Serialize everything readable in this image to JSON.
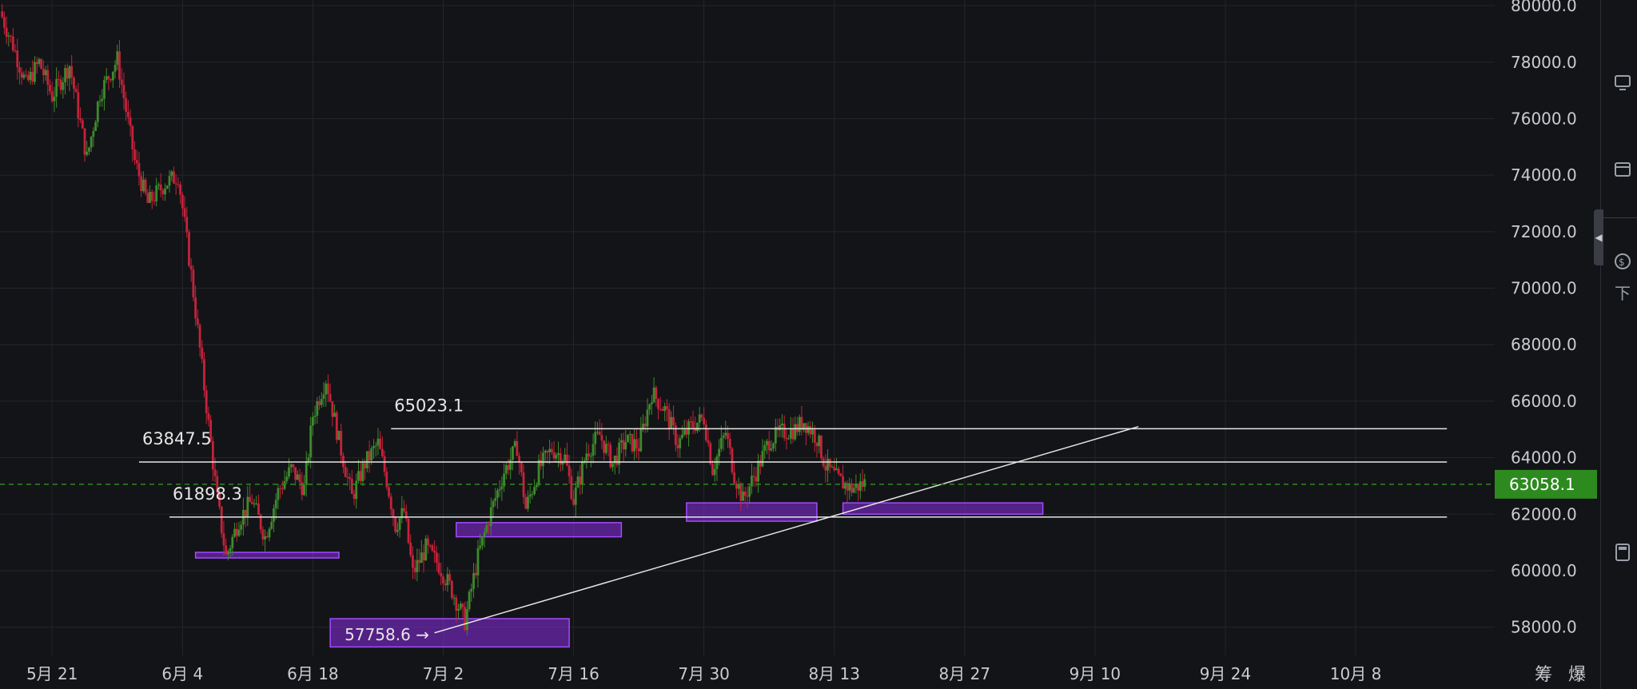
{
  "chart_data": {
    "type": "candlestick",
    "y_ticks": [
      "80000.0",
      "78000.0",
      "76000.0",
      "74000.0",
      "72000.0",
      "70000.0",
      "68000.0",
      "66000.0",
      "64000.0",
      "62000.0",
      "60000.0",
      "58000.0"
    ],
    "ylim": [
      57000,
      80200
    ],
    "x_ticks": [
      "5月 21",
      "6月 4",
      "6月 18",
      "7月 2",
      "7月 16",
      "7月 30",
      "8月 13",
      "8月 27",
      "9月 10",
      "9月 24",
      "10月 8"
    ],
    "current_price": "63058.1",
    "price_path": [
      [
        0,
        79800
      ],
      [
        3,
        78600
      ],
      [
        6,
        77200
      ],
      [
        9,
        78000
      ],
      [
        12,
        76800
      ],
      [
        16,
        77900
      ],
      [
        20,
        74600
      ],
      [
        23,
        76900
      ],
      [
        27,
        78100
      ],
      [
        31,
        74500
      ],
      [
        34,
        73000
      ],
      [
        38,
        73700
      ],
      [
        41,
        74000
      ],
      [
        44,
        70500
      ],
      [
        47,
        66500
      ],
      [
        50,
        62500
      ],
      [
        52,
        60500
      ],
      [
        55,
        61800
      ],
      [
        58,
        62500
      ],
      [
        61,
        61200
      ],
      [
        64,
        62800
      ],
      [
        67,
        63600
      ],
      [
        70,
        62900
      ],
      [
        72,
        65500
      ],
      [
        75,
        66800
      ],
      [
        78,
        64600
      ],
      [
        81,
        62600
      ],
      [
        84,
        63800
      ],
      [
        87,
        64500
      ],
      [
        89,
        63200
      ],
      [
        91,
        61600
      ],
      [
        93,
        62100
      ],
      [
        95,
        59900
      ],
      [
        98,
        60800
      ],
      [
        101,
        60200
      ],
      [
        104,
        59300
      ],
      [
        107,
        58200
      ],
      [
        110,
        60500
      ],
      [
        113,
        62100
      ],
      [
        116,
        63500
      ],
      [
        119,
        64400
      ],
      [
        121,
        62200
      ],
      [
        124,
        63600
      ],
      [
        127,
        64300
      ],
      [
        130,
        64000
      ],
      [
        132,
        62500
      ],
      [
        135,
        64200
      ],
      [
        138,
        64800
      ],
      [
        141,
        63800
      ],
      [
        144,
        64600
      ],
      [
        147,
        64400
      ],
      [
        150,
        66300
      ],
      [
        153,
        65700
      ],
      [
        156,
        64500
      ],
      [
        159,
        65100
      ],
      [
        162,
        65400
      ],
      [
        164,
        63600
      ],
      [
        167,
        64900
      ],
      [
        169,
        63400
      ],
      [
        171,
        62500
      ],
      [
        174,
        63500
      ],
      [
        177,
        64600
      ],
      [
        180,
        64900
      ],
      [
        183,
        65000
      ],
      [
        185,
        65300
      ],
      [
        188,
        64700
      ],
      [
        190,
        63700
      ],
      [
        193,
        63200
      ],
      [
        196,
        62900
      ],
      [
        199,
        63100
      ]
    ],
    "x_domain": [
      0,
      344
    ],
    "x_tick_pos": [
      12,
      42,
      72,
      102,
      132,
      162,
      192,
      222,
      252,
      282,
      312
    ],
    "levels": [
      {
        "label": "65023.1",
        "value": 65023.1,
        "x_from": 90,
        "x_to": 333
      },
      {
        "label": "63847.5",
        "value": 63847.5,
        "x_from": 32,
        "x_to": 333
      },
      {
        "label": "61898.3",
        "value": 61898.3,
        "x_from": 39,
        "x_to": 333
      }
    ],
    "low_annotation": "57758.6 →",
    "trendline": {
      "from": [
        100,
        57800
      ],
      "to": [
        262,
        65100
      ]
    },
    "zones": [
      {
        "x_from": 45,
        "x_to": 78,
        "y_from": 60450,
        "y_to": 60650
      },
      {
        "x_from": 76,
        "x_to": 131,
        "y_from": 57300,
        "y_to": 58300
      },
      {
        "x_from": 105,
        "x_to": 143,
        "y_from": 61200,
        "y_to": 61700
      },
      {
        "x_from": 158,
        "x_to": 188,
        "y_from": 61750,
        "y_to": 62400
      },
      {
        "x_from": 194,
        "x_to": 240,
        "y_from": 62000,
        "y_to": 62400
      }
    ],
    "colors": {
      "up": "#3e8a2c",
      "down": "#c4233b",
      "zone": "#8a2be2",
      "current": "#2d8a1f",
      "grid": "#23262c"
    }
  },
  "bottom_right": {
    "label_a": "筹",
    "label_b": "爆"
  },
  "rail": {
    "icon_a": "chart-icon",
    "icon_b": "calendar-icon",
    "icon_c": "coin-icon",
    "label_c": "下",
    "icon_d": "calculator-icon"
  }
}
